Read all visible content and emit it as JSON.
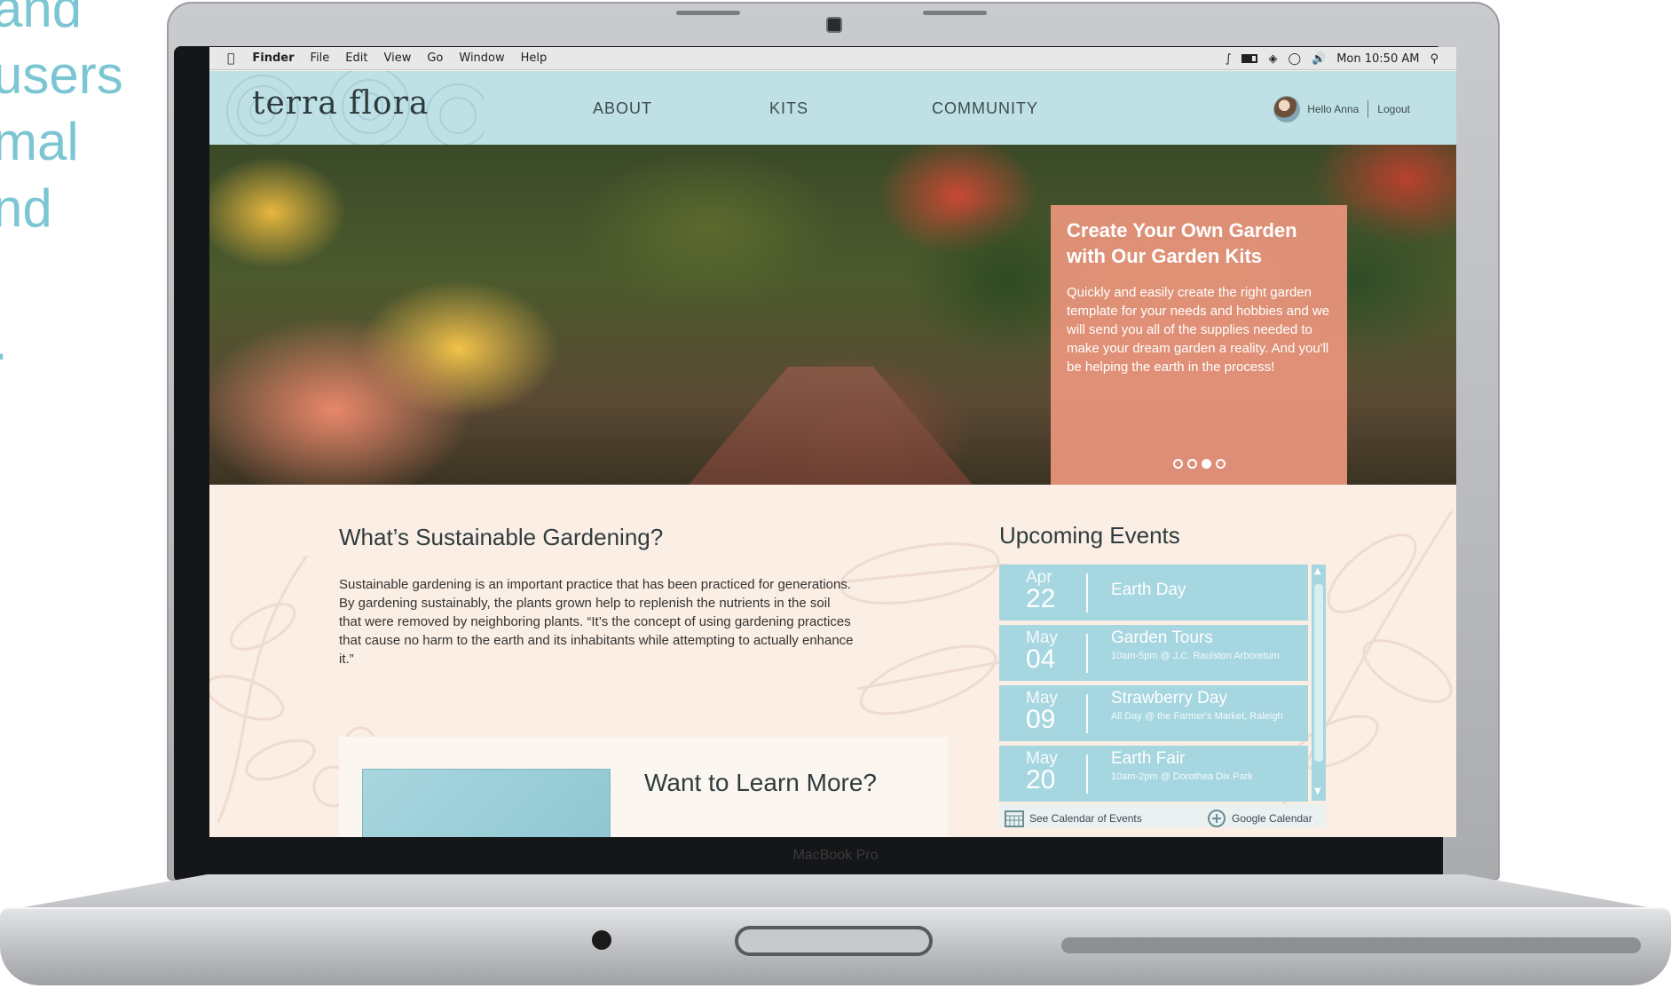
{
  "side_text": {
    "lines": [
      "and",
      "users",
      "mal",
      "nd",
      "",
      "."
    ]
  },
  "laptop": {
    "brand": "MacBook Pro"
  },
  "menubar": {
    "apple": "",
    "items": [
      "Finder",
      "File",
      "Edit",
      "View",
      "Go",
      "Window",
      "Help"
    ],
    "clock": "Mon 10:50 AM"
  },
  "site": {
    "logo": "terra flora",
    "nav": [
      "ABOUT",
      "KITS",
      "COMMUNITY"
    ],
    "greeting": "Hello Anna",
    "logout": "Logout"
  },
  "hero": {
    "title": "Create Your Own Garden with Our Garden Kits",
    "text": "Quickly and easily create the right garden template for your needs and hobbies and we will send you all of the supplies needed to make your dream garden a reality. And you'll be helping the earth in the process!",
    "slides": 4,
    "active_slide": 3
  },
  "article": {
    "title": "What’s Sustainable Gardening?",
    "body": "Sustainable gardening is an important practice that has been practiced for generations. By gardening sustainably, the plants grown help to replenish the nutrients in the soil that were removed by neighboring plants. “It’s the concept of using gardening practices that cause no harm to the earth and its inhabitants while attempting to actually enhance it.”"
  },
  "learn_more": {
    "title": "Want to Learn More?"
  },
  "events": {
    "title": "Upcoming Events",
    "items": [
      {
        "month": "Apr",
        "day": "22",
        "name": "Earth Day",
        "detail": ""
      },
      {
        "month": "May",
        "day": "04",
        "name": "Garden Tours",
        "detail": "10am-5pm @ J.C. Raulston Arboretum"
      },
      {
        "month": "May",
        "day": "09",
        "name": "Strawberry Day",
        "detail": "All Day @ the Farmer's Market, Raleigh"
      },
      {
        "month": "May",
        "day": "20",
        "name": "Earth Fair",
        "detail": "10am-2pm @ Dorothea Dix Park"
      }
    ],
    "calendar_link": "See Calendar of Events",
    "google_link": "Google Calendar"
  },
  "colors": {
    "header": "#bfe1e6",
    "hero_card": "#eb967d",
    "event_bg": "#a6d6e0",
    "content_bg": "#fbeee4",
    "side_text": "#7cc6d3"
  }
}
